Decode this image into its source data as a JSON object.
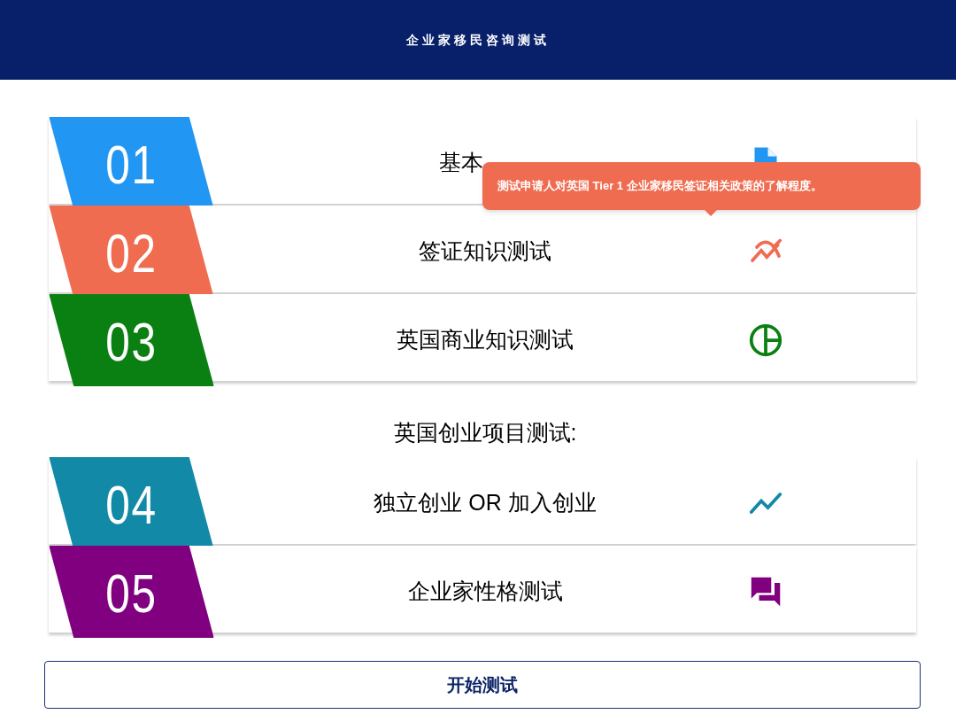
{
  "header": {
    "title": "企业家移民咨询测试"
  },
  "items": [
    {
      "kind": "step",
      "number": "01",
      "label": "基本",
      "color": "#2196f3"
    },
    {
      "kind": "step",
      "number": "02",
      "label": "签证知识测试",
      "color": "#ef6c50"
    },
    {
      "kind": "step",
      "number": "03",
      "label": "英国商业知识测试",
      "color": "#0b8012"
    },
    {
      "kind": "heading",
      "label": "英国创业项目测试:"
    },
    {
      "kind": "step",
      "number": "04",
      "label": "独立创业 OR 加入创业",
      "color": "#1289a7"
    },
    {
      "kind": "step",
      "number": "05",
      "label": "企业家性格测试",
      "color": "#800080"
    }
  ],
  "tooltip": {
    "text": "测试申请人对英国 Tier 1 企业家移民签证相关政策的了解程度。"
  },
  "start_button": {
    "label": "开始测试"
  }
}
